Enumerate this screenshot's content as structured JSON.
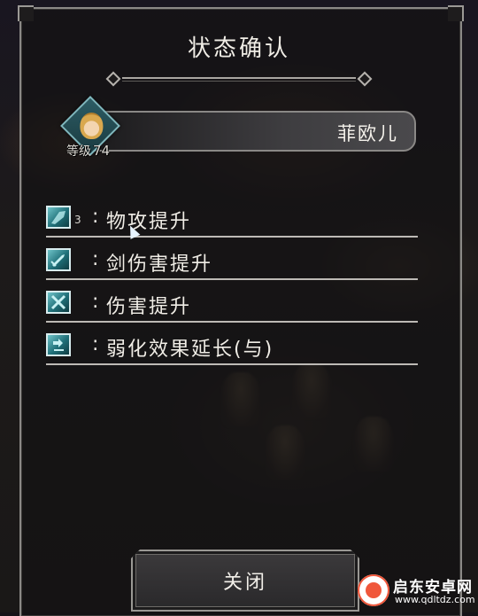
{
  "dialog": {
    "title": "状态确认",
    "close_label": "关闭"
  },
  "character": {
    "name": "菲欧儿",
    "level_label": "等级",
    "level_value": "74"
  },
  "effects": [
    {
      "icon": "physical-attack-up-icon",
      "stack": "3",
      "label": "物攻提升"
    },
    {
      "icon": "sword-damage-up-icon",
      "stack": "",
      "label": "剑伤害提升"
    },
    {
      "icon": "damage-up-icon",
      "stack": "",
      "label": "伤害提升"
    },
    {
      "icon": "debuff-extend-icon",
      "stack": "",
      "label": "弱化效果延长(与)"
    }
  ],
  "effect_colon": ":",
  "watermark": {
    "name": "启东安卓网",
    "url": "www.qdltdz.com"
  },
  "colors": {
    "panel_border": "#8b8986",
    "icon_teal": "#1f6f78",
    "text": "#f0ede6"
  }
}
